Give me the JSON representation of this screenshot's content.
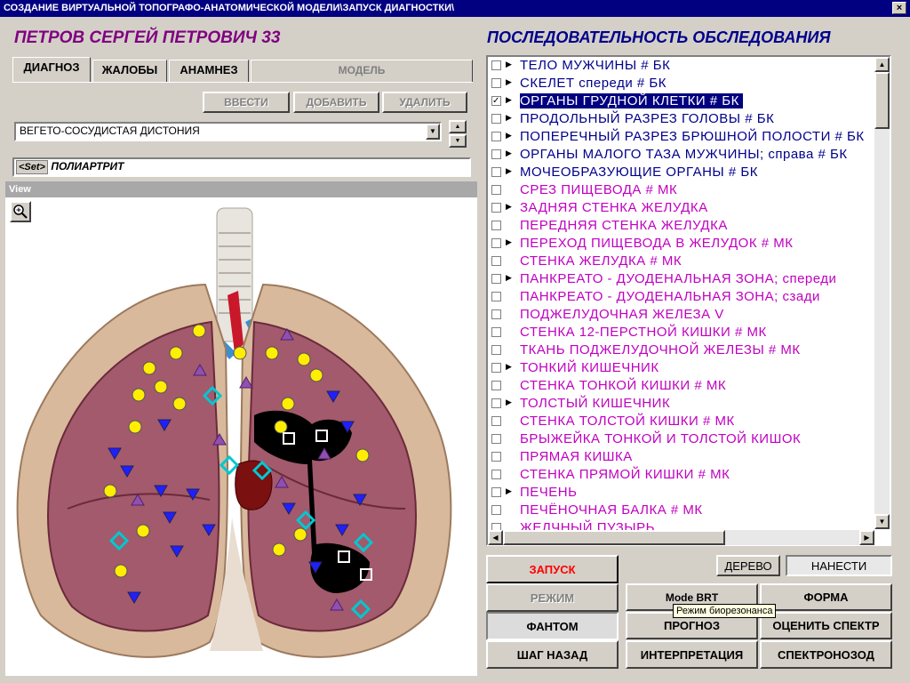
{
  "window": {
    "title": "СОЗДАНИЕ ВИРТУАЛЬНОЙ ТОПОГРАФО-АНАТОМИЧЕСКОЙ МОДЕЛИ\\ЗАПУСК ДИАГНОСТКИ\\",
    "close": "×"
  },
  "patient": {
    "name": "ПЕТРОВ СЕРГЕЙ ПЕТРОВИЧ  33"
  },
  "tabs": [
    {
      "label": "ДИАГНОЗ"
    },
    {
      "label": "ЖАЛОБЫ"
    },
    {
      "label": "АНАМНЕЗ"
    },
    {
      "label": "МОДЕЛЬ"
    }
  ],
  "diag_buttons": {
    "enter": "ВВЕСТИ",
    "add": "ДОБАВИТЬ",
    "delete": "УДАЛИТЬ"
  },
  "diagnosis": {
    "selected": "ВЕГЕТО-СОСУДИСТАЯ ДИСТОНИЯ",
    "set_tag": "<Set>",
    "set_value": "ПОЛИАРТРИТ"
  },
  "view": {
    "header": "View"
  },
  "sequence": {
    "title": "ПОСЛЕДОВАТЕЛЬНОСТЬ ОБСЛЕДОВАНИЯ",
    "items": [
      {
        "label": "ТЕЛО МУЖЧИНЫ # БК",
        "checked": false,
        "arrow": true,
        "style": "blue"
      },
      {
        "label": "СКЕЛЕТ спереди # БК",
        "checked": false,
        "arrow": true,
        "style": "blue"
      },
      {
        "label": "ОРГАНЫ ГРУДНОЙ КЛЕТКИ # БК",
        "checked": true,
        "arrow": true,
        "style": "sel"
      },
      {
        "label": "ПРОДОЛЬНЫЙ РАЗРЕЗ ГОЛОВЫ # БК",
        "checked": false,
        "arrow": true,
        "style": "blue"
      },
      {
        "label": "ПОПЕРЕЧНЫЙ РАЗРЕЗ БРЮШНОЙ ПОЛОСТИ # БК",
        "checked": false,
        "arrow": true,
        "style": "blue"
      },
      {
        "label": "ОРГАНЫ МАЛОГО ТАЗА МУЖЧИНЫ; справа # БК",
        "checked": false,
        "arrow": true,
        "style": "blue"
      },
      {
        "label": "МОЧЕОБРАЗУЮЩИЕ ОРГАНЫ # БК",
        "checked": false,
        "arrow": true,
        "style": "blue"
      },
      {
        "label": "СРЕЗ ПИЩЕВОДА # МК",
        "checked": false,
        "arrow": false,
        "style": "mag"
      },
      {
        "label": "ЗАДНЯЯ СТЕНКА ЖЕЛУДКА",
        "checked": false,
        "arrow": true,
        "style": "mag"
      },
      {
        "label": "ПЕРЕДНЯЯ СТЕНКА ЖЕЛУДКА",
        "checked": false,
        "arrow": false,
        "style": "mag"
      },
      {
        "label": "ПЕРЕХОД ПИЩЕВОДА В ЖЕЛУДОК # МК",
        "checked": false,
        "arrow": true,
        "style": "mag"
      },
      {
        "label": "СТЕНКА ЖЕЛУДКА # МК",
        "checked": false,
        "arrow": false,
        "style": "mag"
      },
      {
        "label": "ПАНКРЕАТО - ДУОДЕНАЛЬНАЯ ЗОНА;  спереди",
        "checked": false,
        "arrow": true,
        "style": "mag"
      },
      {
        "label": "ПАНКРЕАТО - ДУОДЕНАЛЬНАЯ ЗОНА;  сзади",
        "checked": false,
        "arrow": false,
        "style": "mag"
      },
      {
        "label": "ПОДЖЕЛУДОЧНАЯ ЖЕЛЕЗА V",
        "checked": false,
        "arrow": false,
        "style": "mag"
      },
      {
        "label": "СТЕНКА 12-ПЕРСТНОЙ КИШКИ # МК",
        "checked": false,
        "arrow": false,
        "style": "mag"
      },
      {
        "label": "ТКАНЬ ПОДЖЕЛУДОЧНОЙ ЖЕЛЕЗЫ # МК",
        "checked": false,
        "arrow": false,
        "style": "mag"
      },
      {
        "label": "ТОНКИЙ КИШЕЧНИК",
        "checked": false,
        "arrow": true,
        "style": "mag"
      },
      {
        "label": "СТЕНКА ТОНКОЙ КИШКИ # МК",
        "checked": false,
        "arrow": false,
        "style": "mag"
      },
      {
        "label": "ТОЛСТЫЙ КИШЕЧНИК",
        "checked": false,
        "arrow": true,
        "style": "mag"
      },
      {
        "label": "СТЕНКА ТОЛСТОЙ КИШКИ # МК",
        "checked": false,
        "arrow": false,
        "style": "mag"
      },
      {
        "label": "БРЫЖЕЙКА ТОНКОЙ И ТОЛСТОЙ КИШОК",
        "checked": false,
        "arrow": false,
        "style": "mag"
      },
      {
        "label": "ПРЯМАЯ КИШКА",
        "checked": false,
        "arrow": false,
        "style": "mag"
      },
      {
        "label": "СТЕНКА ПРЯМОЙ КИШКИ # МК",
        "checked": false,
        "arrow": false,
        "style": "mag"
      },
      {
        "label": "ПЕЧЕНЬ",
        "checked": false,
        "arrow": true,
        "style": "mag"
      },
      {
        "label": "ПЕЧЁНОЧНАЯ БАЛКА # МК",
        "checked": false,
        "arrow": false,
        "style": "mag"
      },
      {
        "label": "ЖЕЛЧНЫЙ ПУЗЫРЬ",
        "checked": false,
        "arrow": false,
        "style": "mag"
      }
    ]
  },
  "buttons": {
    "launch": "ЗАПУСК",
    "tree": "ДЕРЕВО",
    "apply": "НАНЕСТИ",
    "mode": "РЕЖИМ",
    "mode_brt": "Mode BRT",
    "form": "ФОРМА",
    "phantom": "ФАНТОМ",
    "prognosis": "ПРОГНОЗ",
    "evaluate": "ОЦЕНИТЬ СПЕКТР",
    "step_back": "ШАГ НАЗАД",
    "interpretation": "ИНТЕРПРЕТАЦИЯ",
    "spectronosode": "СПЕКТРОНОЗОД"
  },
  "tooltip": "Режим биорезонанса",
  "colors": {
    "launch_text": "#ff0000",
    "selection": "#000080",
    "list_blue": "#00008b",
    "list_magenta": "#c000c0",
    "patient": "#800080"
  }
}
